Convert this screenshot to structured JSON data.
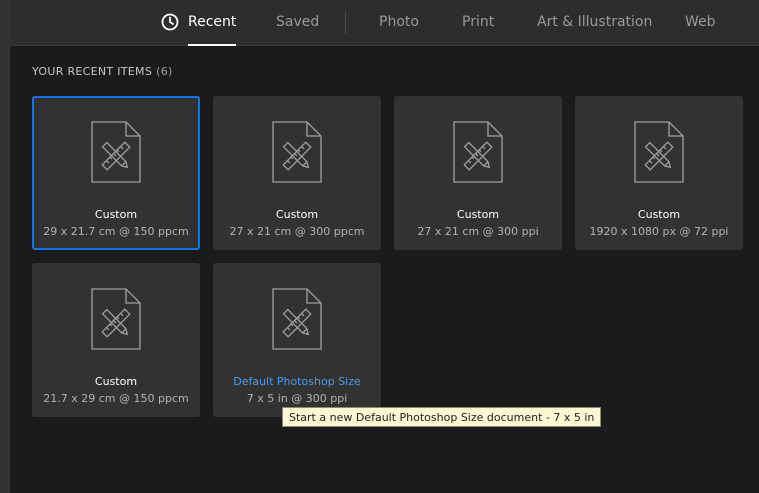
{
  "tabs": {
    "recent": "Recent",
    "saved": "Saved",
    "photo": "Photo",
    "print": "Print",
    "art": "Art & Illustration",
    "web": "Web"
  },
  "section": {
    "title": "YOUR RECENT ITEMS",
    "count": "(6)"
  },
  "items": [
    {
      "name": "Custom",
      "dims": "29 x 21.7 cm @ 150 ppcm"
    },
    {
      "name": "Custom",
      "dims": "27 x 21 cm @ 300 ppcm"
    },
    {
      "name": "Custom",
      "dims": "27 x 21 cm @ 300 ppi"
    },
    {
      "name": "Custom",
      "dims": "1920 x 1080 px @ 72 ppi"
    },
    {
      "name": "Custom",
      "dims": "21.7 x 29 cm @ 150 ppcm"
    },
    {
      "name": "Default Photoshop Size",
      "dims": "7 x 5 in @ 300 ppi"
    }
  ],
  "tooltip": "Start a new Default Photoshop Size document - 7 x 5 in",
  "colors": {
    "accent": "#1473e6",
    "link": "#4c9bf0",
    "card": "#323232",
    "background": "#1b1b1b"
  }
}
